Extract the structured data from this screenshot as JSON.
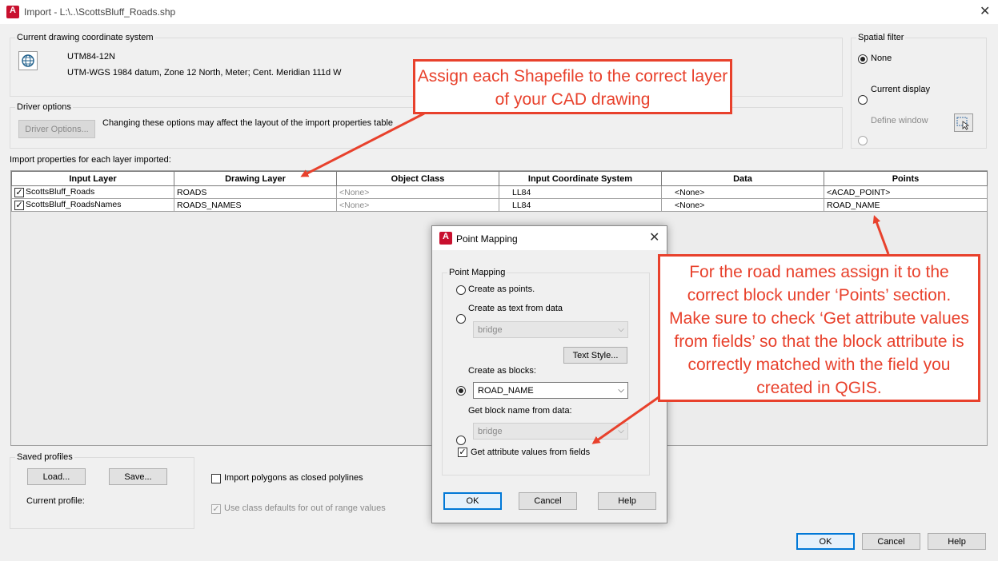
{
  "window": {
    "title": "Import - L:\\..\\ScottsBluff_Roads.shp",
    "app_icon": "A"
  },
  "coord_system": {
    "label": "Current drawing coordinate system",
    "code": "UTM84-12N",
    "description": "UTM-WGS 1984 datum, Zone 12 North, Meter; Cent. Meridian 111d W"
  },
  "driver": {
    "label": "Driver options",
    "button": "Driver Options...",
    "note": "Changing these options may affect the layout of the import properties table"
  },
  "spatial_filter": {
    "label": "Spatial filter",
    "options": [
      "None",
      "Current display",
      "Define window"
    ],
    "selected": "None"
  },
  "import_props": {
    "label": "Import properties for each layer imported:",
    "columns": [
      "Input Layer",
      "Drawing Layer",
      "Object Class",
      "Input Coordinate System",
      "Data",
      "Points"
    ],
    "rows": [
      {
        "checked": true,
        "input_layer": "ScottsBluff_Roads",
        "drawing_layer": "ROADS",
        "object_class": "<None>",
        "coord_sys": "LL84",
        "data": "<None>",
        "points": "<ACAD_POINT>"
      },
      {
        "checked": true,
        "input_layer": "ScottsBluff_RoadsNames",
        "drawing_layer": "ROADS_NAMES",
        "object_class": "<None>",
        "coord_sys": "LL84",
        "data": "<None>",
        "points": "ROAD_NAME"
      }
    ]
  },
  "saved_profiles": {
    "label": "Saved profiles",
    "load": "Load...",
    "save": "Save...",
    "current_profile": "Current profile:"
  },
  "options": {
    "closed_polylines": "Import polygons as closed polylines",
    "class_defaults": "Use class defaults for out of range values"
  },
  "footer": {
    "ok": "OK",
    "cancel": "Cancel",
    "help": "Help"
  },
  "point_mapping": {
    "title": "Point Mapping",
    "group": "Point Mapping",
    "as_points": "Create as points.",
    "as_text": "Create as text from data",
    "text_field": "bridge",
    "text_style": "Text Style...",
    "as_blocks": "Create as blocks:",
    "block_value": "ROAD_NAME",
    "block_from_data": "Get block name from data:",
    "block_field": "bridge",
    "get_attr": "Get attribute values from fields",
    "ok": "OK",
    "cancel": "Cancel",
    "help": "Help"
  },
  "callouts": {
    "top": "Assign each Shapefile to the correct layer of your CAD drawing",
    "right": "For the road names assign it to the correct block under ‘Points’ section. Make sure to check ‘Get attribute values from fields’ so that the block attribute is correctly matched with the field you created in QGIS.",
    "color": "#e8412c"
  }
}
